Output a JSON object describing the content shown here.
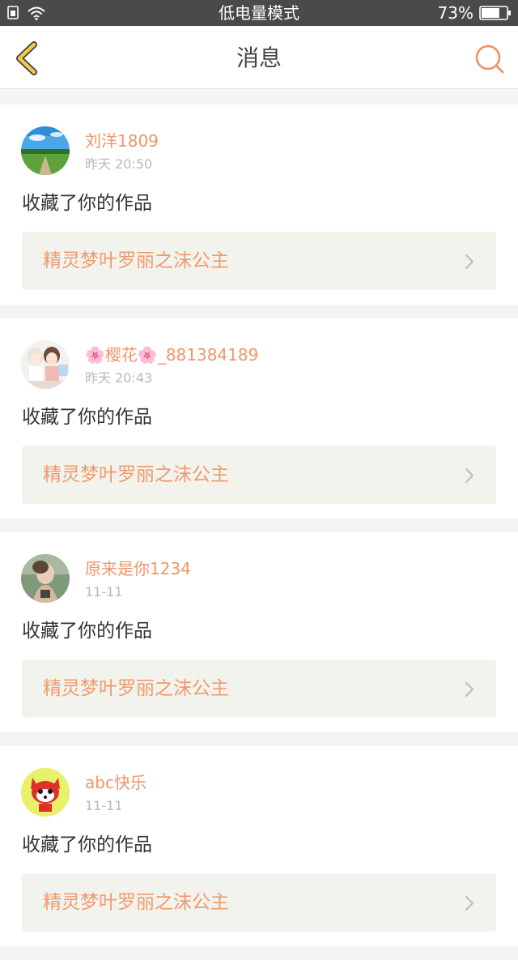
{
  "status_bar": {
    "mode": "低电量模式",
    "battery_percent": "73%",
    "battery_level": 0.73,
    "icons": [
      "sim-icon",
      "wifi-icon",
      "battery-icon"
    ]
  },
  "header": {
    "title": "消息",
    "back_icon": "chevron-left-icon",
    "search_icon": "search-icon"
  },
  "colors": {
    "accent": "#f0956a",
    "back_icon": "#f2c94c",
    "status_bar": "#4a4a4a",
    "work_card_bg": "#f3f3ee"
  },
  "messages": [
    {
      "username": "刘洋1809",
      "time": "昨天 20:50",
      "action": "收藏了你的作品",
      "work_title": "精灵梦叶罗丽之沫公主",
      "avatar": "landscape-avatar"
    },
    {
      "username_prefix": "🌸",
      "username_name": "樱花",
      "username_suffix": "🌸",
      "username_tail": "_881384189",
      "time": "昨天 20:43",
      "action": "收藏了你的作品",
      "work_title": "精灵梦叶罗丽之沫公主",
      "avatar": "anime-couple-avatar"
    },
    {
      "username": "原来是你1234",
      "time": "11-11",
      "action": "收藏了你的作品",
      "work_title": "精灵梦叶罗丽之沫公主",
      "avatar": "portrait-avatar"
    },
    {
      "username": "abc快乐",
      "time": "11-11",
      "action": "收藏了你的作品",
      "work_title": "精灵梦叶罗丽之沫公主",
      "avatar": "cartoon-fox-avatar"
    }
  ]
}
